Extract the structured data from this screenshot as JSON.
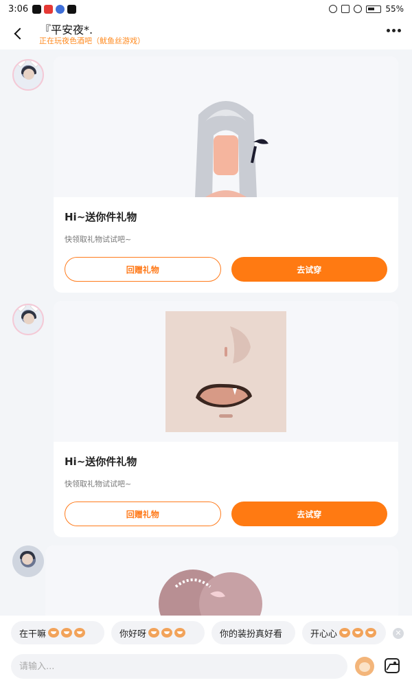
{
  "status_bar": {
    "time": "3:06",
    "battery": "55%"
  },
  "header": {
    "title": "『平安夜*.",
    "subtitle": "正在玩夜色酒吧（鱿鱼丝游戏）"
  },
  "messages": [
    {
      "title": "Hi~送你件礼物",
      "desc": "快领取礼物试试吧~",
      "return_label": "回赠礼物",
      "try_label": "去试穿",
      "item": "hair"
    },
    {
      "title": "Hi~送你件礼物",
      "desc": "快领取礼物试试吧~",
      "return_label": "回赠礼物",
      "try_label": "去试穿",
      "item": "face"
    }
  ],
  "quick_replies": [
    {
      "text": "在干嘛"
    },
    {
      "text": "你好呀"
    },
    {
      "text": "你的装扮真好看"
    },
    {
      "text": "开心心"
    }
  ],
  "input": {
    "placeholder": "请输入..."
  },
  "icons": {
    "back": "back-arrow-icon",
    "more": "more-dots-icon",
    "emoji": "emoji-icon",
    "image": "image-icon",
    "close": "close-icon"
  },
  "colors": {
    "accent": "#ff7a12",
    "subtitle": "#ff8a1f",
    "background": "#f3f5f8"
  }
}
